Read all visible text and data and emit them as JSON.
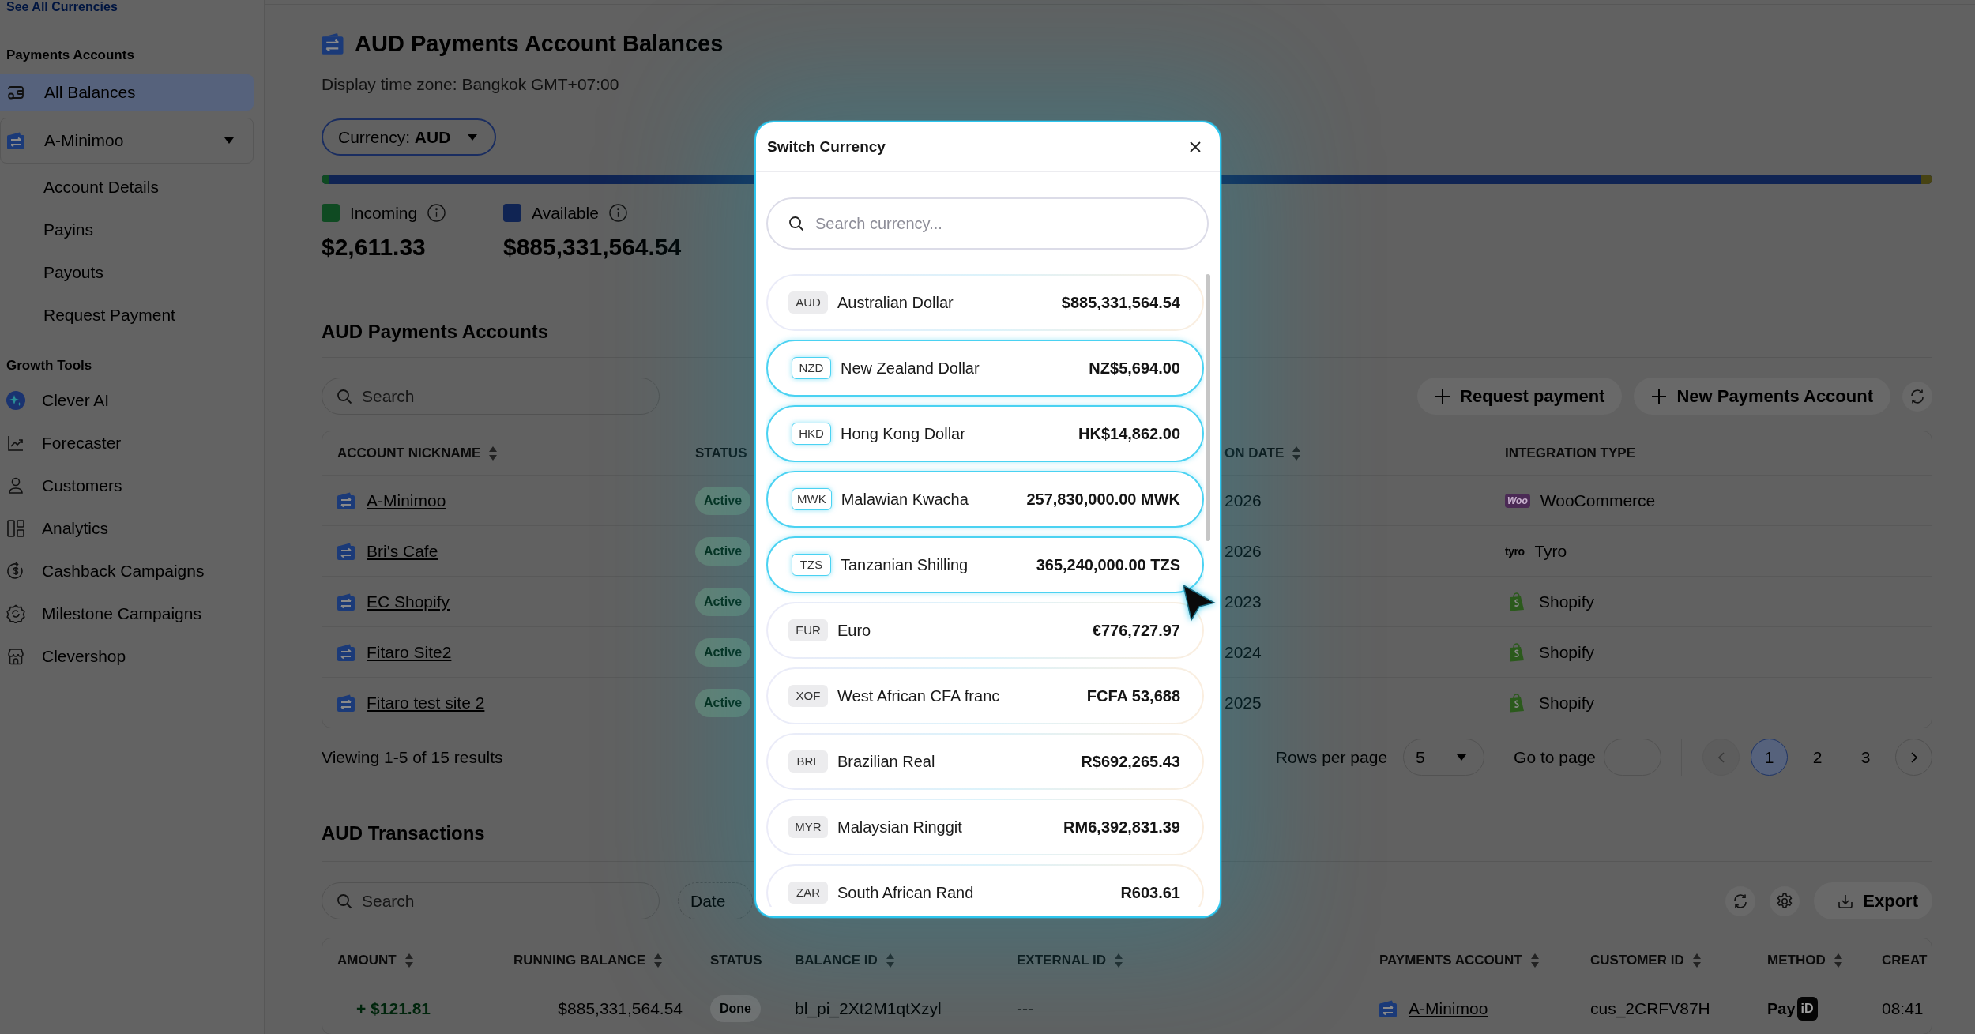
{
  "sidebar": {
    "top_link": "See All Currencies",
    "payments_heading": "Payments Accounts",
    "all_balances": {
      "label": "All Balances",
      "selected": true
    },
    "account": {
      "label": "A-Minimoo",
      "selected": false,
      "expanded": true,
      "children": [
        {
          "label": "Account Details",
          "selected": false
        },
        {
          "label": "Payins",
          "selected": false
        },
        {
          "label": "Payouts",
          "selected": false
        },
        {
          "label": "Request Payment",
          "selected": false
        }
      ]
    },
    "growth_heading": "Growth Tools",
    "growth_items": [
      {
        "label": "Clever AI",
        "selected": false
      },
      {
        "label": "Forecaster",
        "selected": false
      },
      {
        "label": "Customers",
        "selected": false
      },
      {
        "label": "Analytics",
        "selected": false
      },
      {
        "label": "Cashback Campaigns",
        "selected": false
      },
      {
        "label": "Milestone Campaigns",
        "selected": false
      },
      {
        "label": "Clevershop",
        "selected": false
      }
    ]
  },
  "page": {
    "title": "AUD Payments Account Balances",
    "timezone": "Display time zone: Bangkok GMT+07:00",
    "currency_select": "Currency: **AUD**",
    "balance_bar": {
      "segments": [
        {
          "color": "#0f4a22",
          "level": 0.005
        },
        {
          "color": "#474313",
          "level": 0.007
        }
      ]
    },
    "balances": [
      {
        "label": "Incoming",
        "color": "#0f4a22",
        "amount": "$2,611.33"
      },
      {
        "label": "Available",
        "color": "#102453",
        "amount": "$885,331,564.54"
      }
    ]
  },
  "accounts": {
    "heading": "AUD Payments Accounts",
    "search": {
      "placeholder": "Search"
    },
    "actions": [
      "Request payment",
      "New Payments Account"
    ],
    "table": {
      "columns": [
        {
          "label": "ACCOUNT NICKNAME",
          "sortable": true
        },
        {
          "label": "STATUS",
          "sortable": false
        },
        {
          "label": "ON DATE",
          "sortable": true
        },
        {
          "label": "INTEGRATION TYPE",
          "sortable": false
        }
      ],
      "rows": [
        {
          "nickname": "A-Minimoo",
          "status": "Active",
          "date": "2026",
          "integration": {
            "kind": "bubble",
            "logo_text": "Woo",
            "label": "WooCommerce"
          }
        },
        {
          "nickname": "Bri's Cafe",
          "status": "Active",
          "date": "2026",
          "integration": {
            "kind": "wordmark",
            "logo_text": "tyro",
            "label": "Tyro"
          }
        },
        {
          "nickname": "EC Shopify",
          "status": "Active",
          "date": "2023",
          "integration": {
            "kind": "bag",
            "label": "Shopify"
          }
        },
        {
          "nickname": "Fitaro Site2",
          "status": "Active",
          "date": "2024",
          "integration": {
            "kind": "bag",
            "label": "Shopify"
          }
        },
        {
          "nickname": "Fitaro test site 2",
          "status": "Active",
          "date": "2025",
          "integration": {
            "kind": "bag",
            "label": "Shopify"
          }
        }
      ]
    },
    "footer": {
      "summary": "Viewing 1-5 of 15 results",
      "rows_per_page_label": "Rows per page",
      "rows_per_page": "5",
      "go_to_page_label": "Go to page",
      "prev": {
        "disabled": true
      },
      "pages": [
        {
          "label": "1",
          "selected": true
        },
        {
          "label": "2",
          "selected": false
        },
        {
          "label": "3",
          "selected": false
        }
      ],
      "next": {
        "disabled": false
      }
    }
  },
  "transactions": {
    "heading": "AUD Transactions",
    "search": {
      "placeholder": "Search"
    },
    "date_filter": "Date",
    "export_label": "Export",
    "table": {
      "columns": [
        {
          "label": "AMOUNT",
          "sortable": true
        },
        {
          "label": "RUNNING BALANCE",
          "sortable": true
        },
        {
          "label": "STATUS",
          "sortable": false
        },
        {
          "label": "BALANCE ID",
          "sortable": true
        },
        {
          "label": "EXTERNAL ID",
          "sortable": true
        },
        {
          "label": "PAYMENTS ACCOUNT",
          "sortable": true
        },
        {
          "label": "CUSTOMER ID",
          "sortable": true
        },
        {
          "label": "METHOD",
          "sortable": true
        },
        {
          "label": "CREAT",
          "sortable": false
        }
      ],
      "rows": [
        {
          "amount": "+ $121.81",
          "running_balance": "$885,331,564.54",
          "status": "Done",
          "balance_id": "bl_pi_2Xt2M1qtXzyl",
          "external_id": "---",
          "payments_account": "A-Minimoo",
          "customer_id": "cus_2CRFV87H",
          "method": {
            "text": "Pay",
            "mark": "iD"
          },
          "created": "08:41"
        }
      ]
    }
  },
  "modal": {
    "title": "Switch Currency",
    "search": {
      "placeholder": "Search currency..."
    },
    "currencies": [
      {
        "code": "AUD",
        "name": "Australian Dollar",
        "amount": "$885,331,564.54",
        "highlighted": false
      },
      {
        "code": "NZD",
        "name": "New Zealand Dollar",
        "amount": "NZ$5,694.00",
        "highlighted": true
      },
      {
        "code": "HKD",
        "name": "Hong Kong Dollar",
        "amount": "HK$14,862.00",
        "highlighted": true
      },
      {
        "code": "MWK",
        "name": "Malawian Kwacha",
        "amount": "257,830,000.00 MWK",
        "highlighted": true
      },
      {
        "code": "TZS",
        "name": "Tanzanian Shilling",
        "amount": "365,240,000.00 TZS",
        "highlighted": true
      },
      {
        "code": "EUR",
        "name": "Euro",
        "amount": "€776,727.97",
        "highlighted": false
      },
      {
        "code": "XOF",
        "name": "West African CFA franc",
        "amount": "FCFA 53,688",
        "highlighted": false
      },
      {
        "code": "BRL",
        "name": "Brazilian Real",
        "amount": "R$692,265.43",
        "highlighted": false
      },
      {
        "code": "MYR",
        "name": "Malaysian Ringgit",
        "amount": "RM6,392,831.39",
        "highlighted": false
      },
      {
        "code": "ZAR",
        "name": "South African Rand",
        "amount": "R603.61",
        "highlighted": false
      }
    ]
  }
}
